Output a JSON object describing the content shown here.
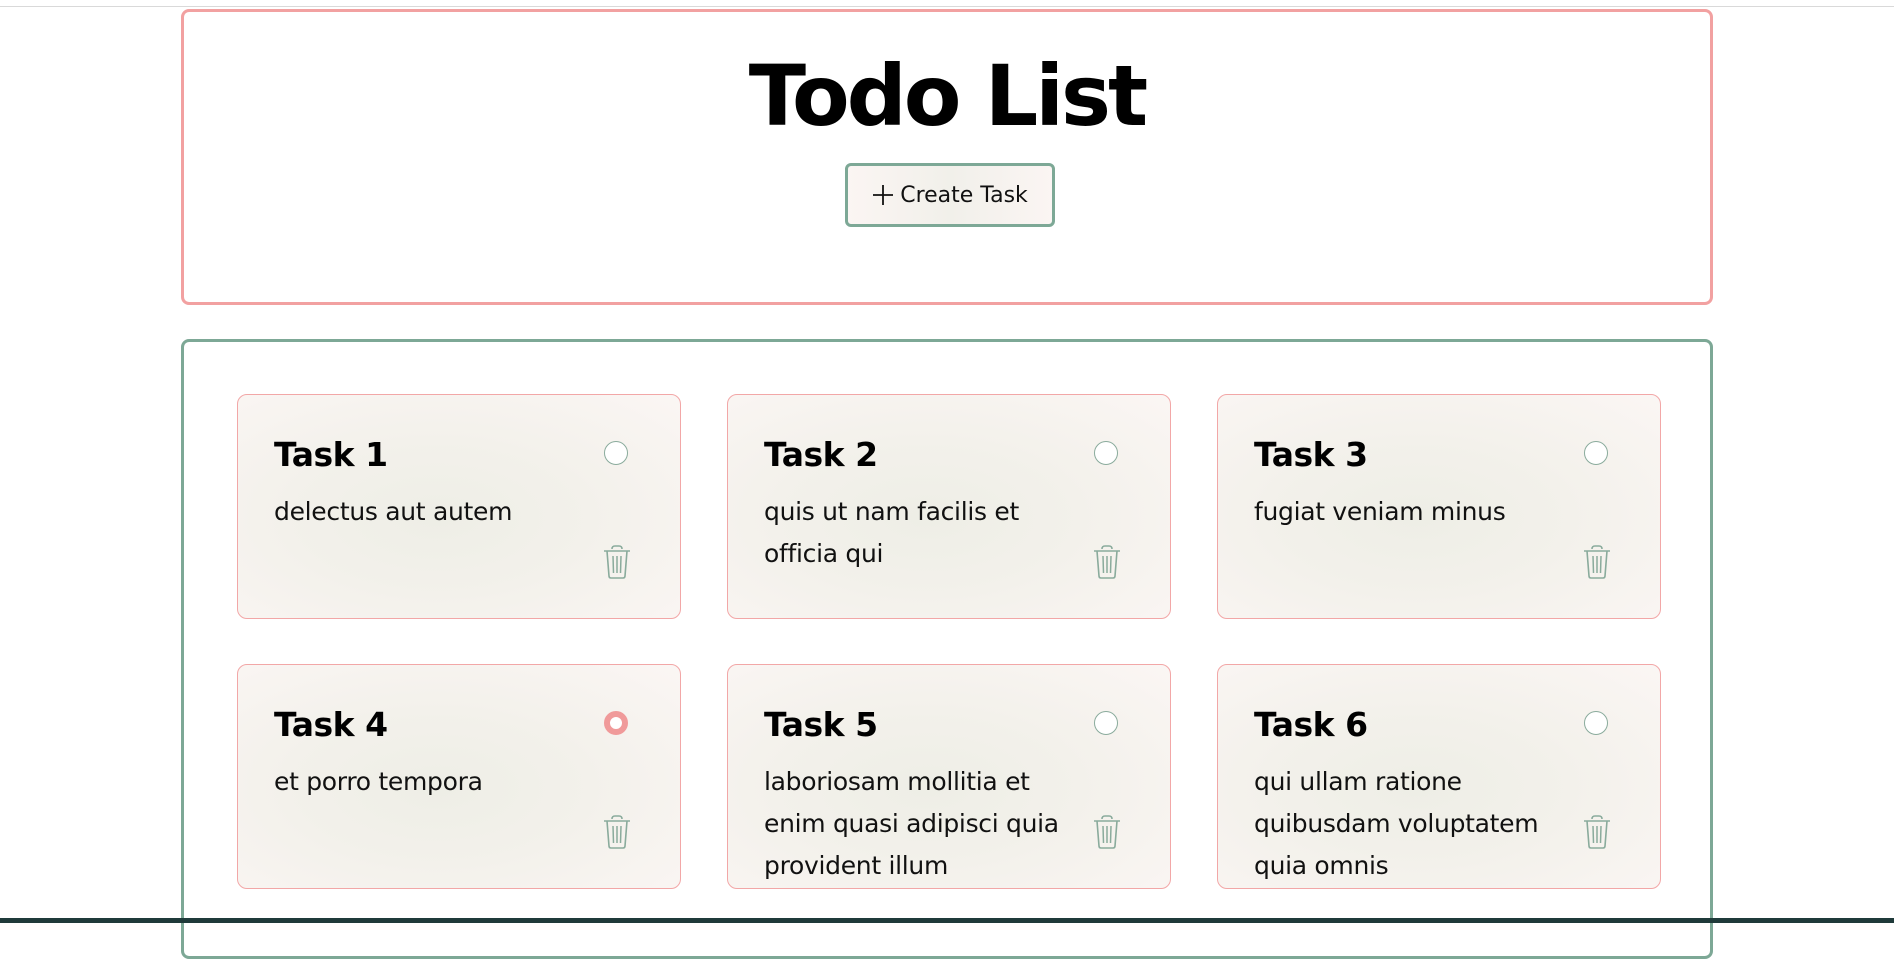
{
  "header": {
    "title": "Todo List",
    "create_button_label": "Create Task"
  },
  "tasks": [
    {
      "title": "Task 1",
      "description": "delectus aut autem",
      "completed": false
    },
    {
      "title": "Task 2",
      "description": "quis ut nam facilis et officia qui",
      "completed": false
    },
    {
      "title": "Task 3",
      "description": "fugiat veniam minus",
      "completed": false
    },
    {
      "title": "Task 4",
      "description": "et porro tempora",
      "completed": true
    },
    {
      "title": "Task 5",
      "description": "laboriosam mollitia et enim quasi adipisci quia provident illum",
      "completed": false
    },
    {
      "title": "Task 6",
      "description": "qui ullam ratione quibusdam voluptatem quia omnis",
      "completed": false
    }
  ],
  "icons": {
    "create": "plus-icon",
    "delete": "trash-icon",
    "status": "radio-icon"
  },
  "colors": {
    "header_border": "#f2a1a1",
    "list_border": "#7da896",
    "card_border": "#f2a7a7",
    "checked_radio": "#f09a9a",
    "icon_green": "#8aab9c"
  }
}
